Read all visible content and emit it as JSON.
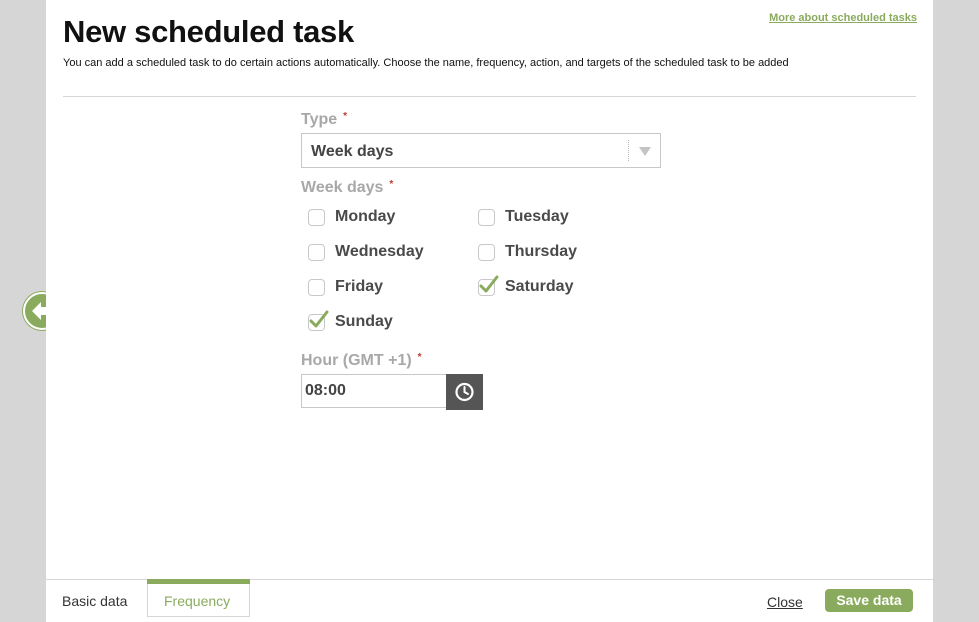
{
  "header": {
    "title": "New scheduled task",
    "subtitle": "You can add a scheduled task to do certain actions automatically. Choose the name, frequency, action, and targets of the scheduled task to be added",
    "more_link": "More about scheduled tasks"
  },
  "form": {
    "type": {
      "label": "Type",
      "required_mark": "*",
      "selected_value": "Week days"
    },
    "week_days": {
      "label": "Week days",
      "required_mark": "*",
      "days": [
        {
          "label": "Monday",
          "checked": false
        },
        {
          "label": "Tuesday",
          "checked": false
        },
        {
          "label": "Wednesday",
          "checked": false
        },
        {
          "label": "Thursday",
          "checked": false
        },
        {
          "label": "Friday",
          "checked": false
        },
        {
          "label": "Saturday",
          "checked": true
        },
        {
          "label": "Sunday",
          "checked": true
        }
      ]
    },
    "hour": {
      "label": "Hour (GMT +1)",
      "required_mark": "*",
      "value": "08:00",
      "button_icon": "clock-icon"
    }
  },
  "navigation": {
    "back_icon": "arrow-left-icon"
  },
  "footer": {
    "tabs": [
      {
        "label": "Basic data",
        "active": false
      },
      {
        "label": "Frequency",
        "active": true
      }
    ],
    "close_label": "Close",
    "save_label": "Save data"
  },
  "colors": {
    "accent": "#8aab5e",
    "background": "#d6d6d6",
    "required": "#c0392b",
    "clock_button": "#555555"
  }
}
